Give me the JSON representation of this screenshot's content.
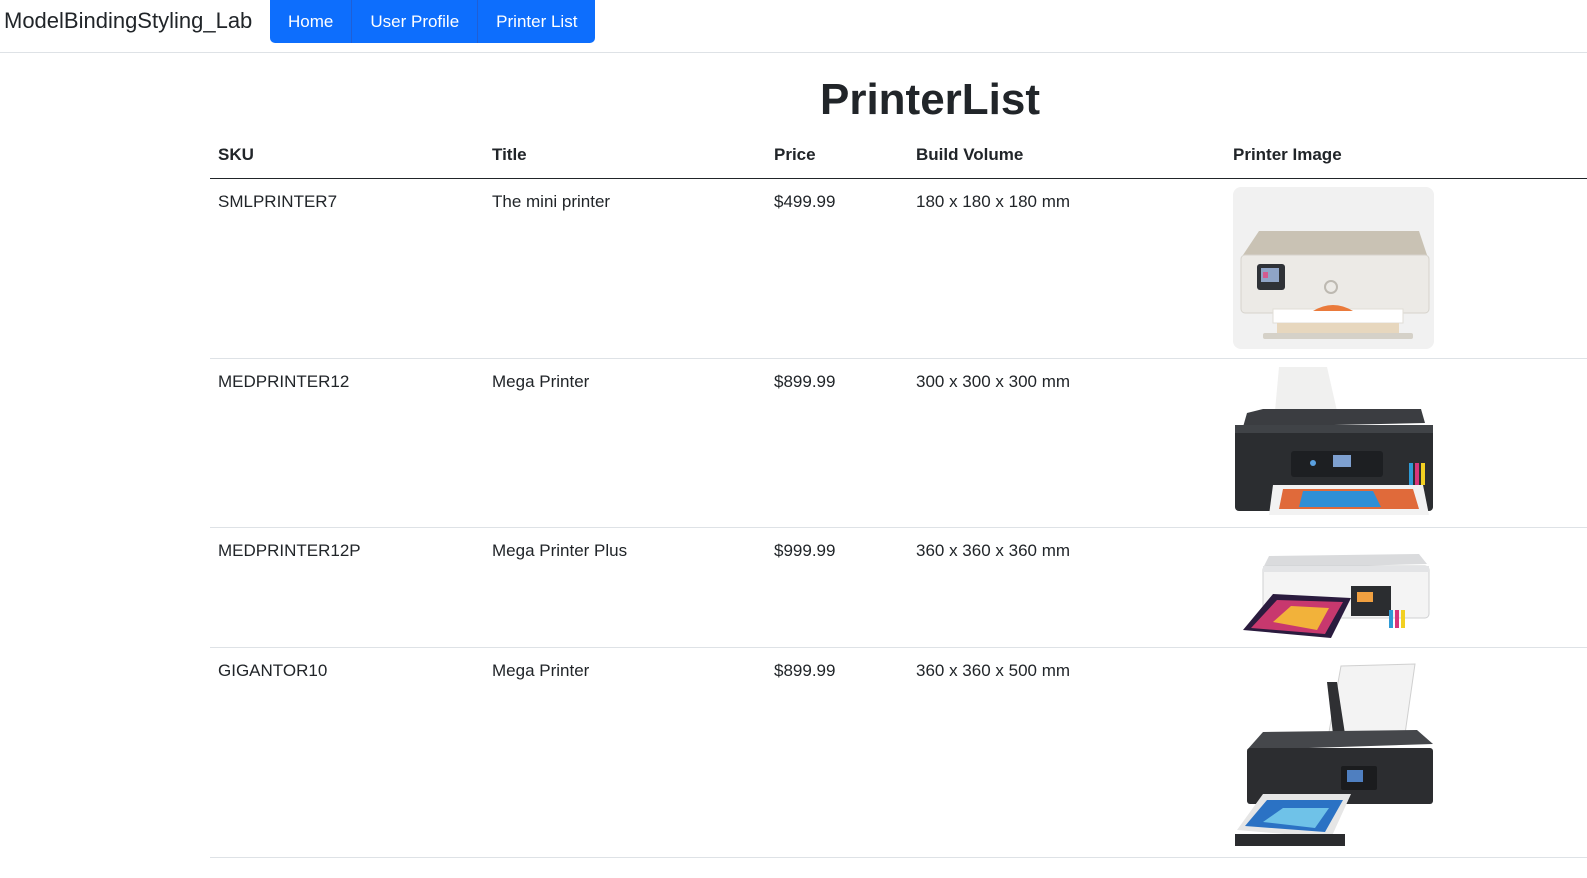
{
  "navbar": {
    "brand": "ModelBindingStyling_Lab",
    "links": [
      {
        "label": "Home"
      },
      {
        "label": "User Profile"
      },
      {
        "label": "Printer List"
      }
    ],
    "accent_color": "#0d6efd"
  },
  "page": {
    "title": "PrinterList"
  },
  "table": {
    "headers": [
      "SKU",
      "Title",
      "Price",
      "Build Volume",
      "Printer Image"
    ],
    "rows": [
      {
        "sku": "SMLPRINTER7",
        "title": "The mini printer",
        "price": "$499.99",
        "build_volume": "180 x 180 x 180 mm",
        "image": "hp-envy-inkjet-printer"
      },
      {
        "sku": "MEDPRINTER12",
        "title": "Mega Printer",
        "price": "$899.99",
        "build_volume": "300 x 300 x 300 mm",
        "image": "epson-ecotank-printer"
      },
      {
        "sku": "MEDPRINTER12P",
        "title": "Mega Printer Plus",
        "price": "$999.99",
        "build_volume": "360 x 360 x 360 mm",
        "image": "epson-photo-printer"
      },
      {
        "sku": "GIGANTOR10",
        "title": "Mega Printer",
        "price": "$899.99",
        "build_volume": "360 x 360 x 500 mm",
        "image": "canon-pixma-printer"
      }
    ]
  }
}
